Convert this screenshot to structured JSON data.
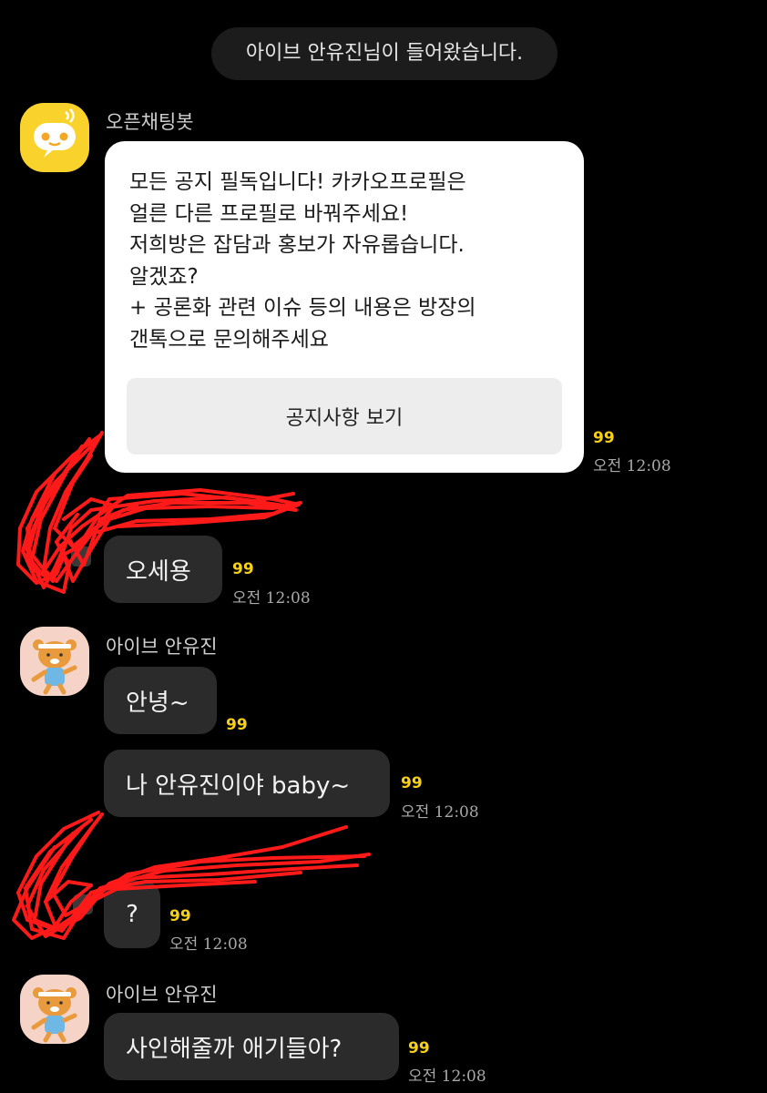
{
  "system_notice": "아이브 안유진님이 들어왔습니다.",
  "bot": {
    "name": "오픈채팅봇",
    "notice_lines": "모든 공지 필독입니다! 카카오프로필은\n얼른 다른 프로필로 바꿔주세요!\n저희방은 잡담과 홍보가 자유롭습니다.\n알겠죠?\n + 공론화  관련 이슈 등의 내용은 방장의\n갠톡으로 문의해주세요",
    "button_label": "공지사항 보기",
    "unread": "99",
    "time": "오전 12:08"
  },
  "messages": [
    {
      "text": "오세용",
      "unread": "99",
      "time": "오전 12:08"
    },
    {
      "sender": "아이브 안유진"
    },
    {
      "text": "안녕~",
      "unread": "99"
    },
    {
      "text": "나 안유진이야 baby~",
      "unread": "99",
      "time": "오전 12:08"
    },
    {
      "text": "?",
      "unread": "99",
      "time": "오전 12:08"
    },
    {
      "sender": "아이브 안유진",
      "text": "사인해줄까 애기들아?",
      "unread": "99",
      "time": "오전 12:08"
    }
  ],
  "colors": {
    "background": "#000000",
    "bubble": "#2b2b2b",
    "unread_count": "#f7d117",
    "scribble": "#ff1a1a",
    "bot_avatar": "#f9d22c"
  },
  "icons": [
    "chatbot-avatar-icon",
    "ryan-character-avatar-icon"
  ]
}
